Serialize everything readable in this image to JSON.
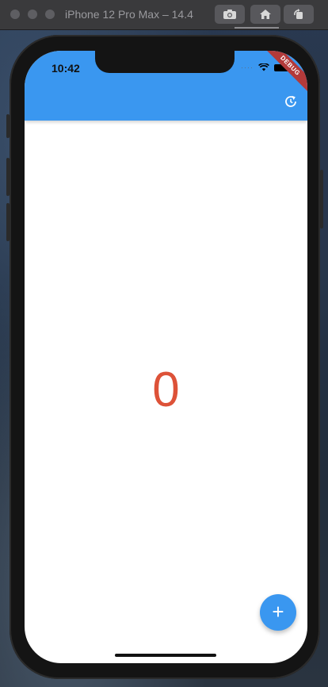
{
  "window": {
    "title": "iPhone 12 Pro Max – 14.4"
  },
  "toolbar": {
    "buttons": [
      {
        "icon": "camera-icon"
      },
      {
        "icon": "home-icon"
      },
      {
        "icon": "rotate-icon"
      }
    ]
  },
  "status_bar": {
    "time": "10:42",
    "signal_dots": "····",
    "debug_label": "DEBUG"
  },
  "app": {
    "counter": "0",
    "counter_color": "#dd5238",
    "accent_color": "#3a97f0",
    "refresh_icon": "refresh-icon",
    "fab_label": "+"
  }
}
